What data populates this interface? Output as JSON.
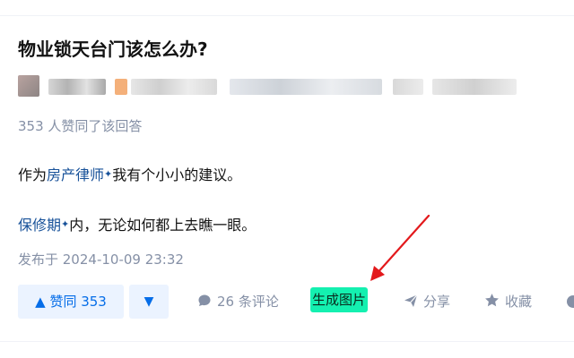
{
  "answer": {
    "question_title": "物业锁天台门该怎么办?",
    "votes_line": "353 人赞同了该回答",
    "paragraph1": {
      "before": "作为",
      "keyword": "房产律师",
      "after": "我有个小小的建议。"
    },
    "paragraph2": {
      "keyword": "保修期",
      "after": "内，无论如何都上去瞧一眼。"
    },
    "published": "发布于 2024-10-09 23:32"
  },
  "actions": {
    "upvote_label": "▲ 赞同 353",
    "downvote_label": "▼",
    "comments_label": "26 条评论",
    "generate_image_label": "生成图片",
    "share_label": "分享",
    "favorite_label": "收藏"
  },
  "icons": {
    "keyword_spark": "✦",
    "comment": "speech-bubble-icon",
    "share": "paper-plane-icon",
    "favorite": "star-icon",
    "more": "more-icon"
  },
  "colors": {
    "accent_blue": "#056de8",
    "keyword_blue": "#175199",
    "muted_gray": "#8590a6",
    "highlight_green": "#14f0b0",
    "annotation_red": "#e3191c"
  }
}
